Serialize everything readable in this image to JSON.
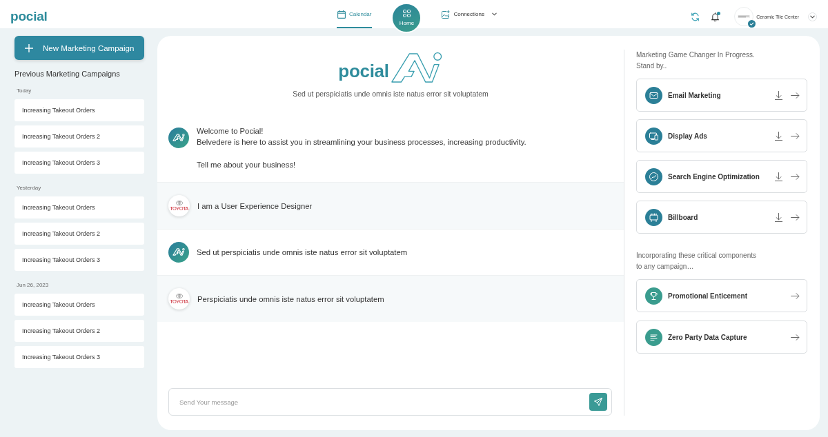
{
  "header": {
    "logo": "pocial",
    "nav": [
      {
        "kind": "tab",
        "label": "Calendar",
        "selected": true
      },
      {
        "kind": "home",
        "label": "Home",
        "selected": false
      },
      {
        "kind": "menu",
        "label": "Connections",
        "selected": false
      }
    ],
    "notifications": {
      "unread": true
    },
    "account": {
      "name": "Ceramic Tile Center",
      "verified": true
    }
  },
  "sidebar": {
    "new_campaign_button": "New Marketing Campaign",
    "title": "Previous Marketing Campaigns",
    "groups": [
      {
        "label": "Today",
        "items": [
          {
            "title": "Increasing Takeout Orders",
            "selected": false
          },
          {
            "title": "Increasing Takeout Orders 2",
            "selected": false
          },
          {
            "title": "Increasing Takeout Orders 3",
            "selected": false
          }
        ]
      },
      {
        "label": "Yesterday",
        "items": [
          {
            "title": "Increasing Takeout Orders",
            "selected": false
          },
          {
            "title": "Increasing Takeout Orders 2",
            "selected": false
          },
          {
            "title": "Increasing Takeout Orders 3",
            "selected": false
          }
        ]
      },
      {
        "label": "Jun 26, 2023",
        "items": [
          {
            "title": "Increasing Takeout Orders",
            "selected": false
          },
          {
            "title": "Increasing Takeout Orders 2",
            "selected": false
          },
          {
            "title": "Increasing Takeout Orders 3",
            "selected": false
          }
        ]
      }
    ]
  },
  "chat": {
    "hero": {
      "logo": "pocial",
      "subtitle": "Sed ut perspiciatis unde omnis iste natus error sit voluptatem"
    },
    "messages": [
      {
        "kind": "bot",
        "paragraphs": [
          [
            "Welcome to Pocial!",
            "Belvedere is here to assist you in streamlining your business processes, increasing productivity."
          ],
          [
            "Tell me about your business!"
          ]
        ]
      },
      {
        "kind": "user",
        "avatar_logo_text": "TOYOTA",
        "paragraphs": [
          [
            "I am a User Experience Designer"
          ]
        ]
      },
      {
        "kind": "bot",
        "paragraphs": [
          [
            "Sed ut perspiciatis unde omnis iste natus error sit voluptatem"
          ]
        ]
      },
      {
        "kind": "user",
        "avatar_logo_text": "TOYOTA",
        "paragraphs": [
          [
            "Perspiciatis unde omnis iste natus error sit voluptatem"
          ]
        ]
      }
    ],
    "composer": {
      "placeholder": "Send Your message"
    }
  },
  "insights": {
    "sections": [
      {
        "intro": [
          "Marketing Game Changer In Progress.",
          "Stand by.."
        ],
        "cards": [
          {
            "kind": "email",
            "title": "Email Marketing",
            "download": true
          },
          {
            "kind": "display",
            "title": "Display Ads",
            "download": true
          },
          {
            "kind": "seo",
            "title": "Search Engine Optimization",
            "download": true
          },
          {
            "kind": "billboard",
            "title": "Billboard",
            "download": true
          }
        ]
      },
      {
        "intro": [
          "Incorporating these critical components",
          "to any campaign…"
        ],
        "cards": [
          {
            "kind": "trophy",
            "title": "Promotional Enticement",
            "download": false
          },
          {
            "kind": "list",
            "title": "Zero Party Data Capture",
            "download": false
          }
        ]
      }
    ]
  }
}
